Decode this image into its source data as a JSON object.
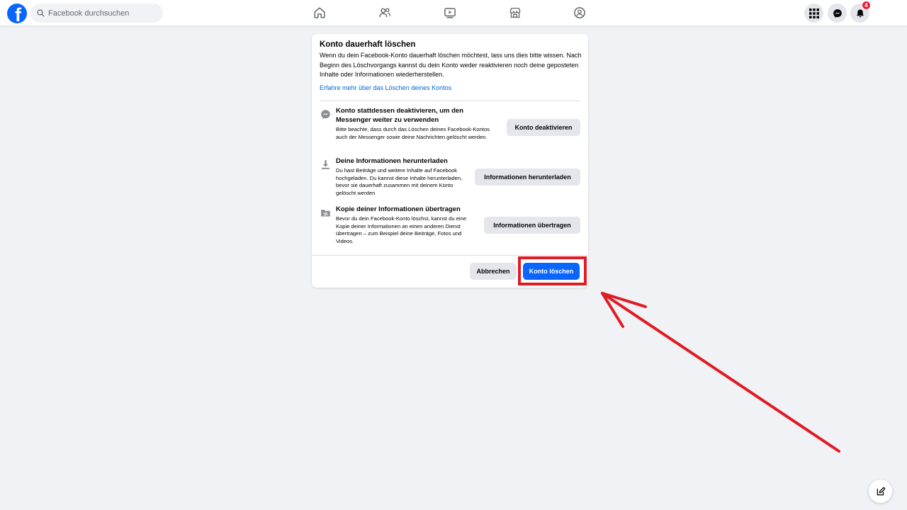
{
  "header": {
    "logo": "f",
    "search_placeholder": "Facebook durchsuchen",
    "nav_icons": [
      "home-icon",
      "friends-icon",
      "video-icon",
      "marketplace-icon",
      "groups-icon"
    ],
    "right_icons": [
      "menu-grid-icon",
      "messenger-icon",
      "notifications-icon"
    ],
    "notification_count": "4"
  },
  "dialog": {
    "title": "Konto dauerhaft löschen",
    "text": "Wenn du dein Facebook-Konto dauerhaft löschen möchtest, lass uns dies bitte wissen. Nach Beginn des Löschvorgangs kannst du dein Konto weder reaktivieren noch deine geposteten Inhalte oder Informationen wiederherstellen.",
    "link": "Erfahre mehr über das Löschen deines Kontos",
    "options": [
      {
        "icon": "messenger-icon",
        "title": "Konto stattdessen deaktivieren, um den Messenger weiter zu verwenden",
        "description": "Bitte beachte, dass durch das Löschen deines Facebook-Kontos auch der Messenger sowie deine Nachrichten gelöscht werden.",
        "button": "Konto deaktivieren"
      },
      {
        "icon": "download-icon",
        "title": "Deine Informationen herunterladen",
        "description": "Du hast                     Beiträge und weitere Inhalte auf Facebook hochgeladen. Du kannst diese Inhalte herunterladen, bevor sie dauerhaft zusammen mit deinem Konto gelöscht werden",
        "button": "Informationen herunterladen"
      },
      {
        "icon": "transfer-icon",
        "title": "Kopie deiner Informationen übertragen",
        "description": "Bevor du dein Facebook-Konto löschst, kannst du eine Kopie deiner Informationen an einen anderen Dienst übertragen – zum Beispiel deine Beiträge, Fotos und Videos.",
        "button": "Informationen übertragen"
      }
    ],
    "cancel_label": "Abbrechen",
    "delete_label": "Konto löschen"
  },
  "colors": {
    "brand": "#0866ff",
    "link": "#0064d1",
    "annotation": "#e01b24",
    "badge": "#e41e3f"
  }
}
